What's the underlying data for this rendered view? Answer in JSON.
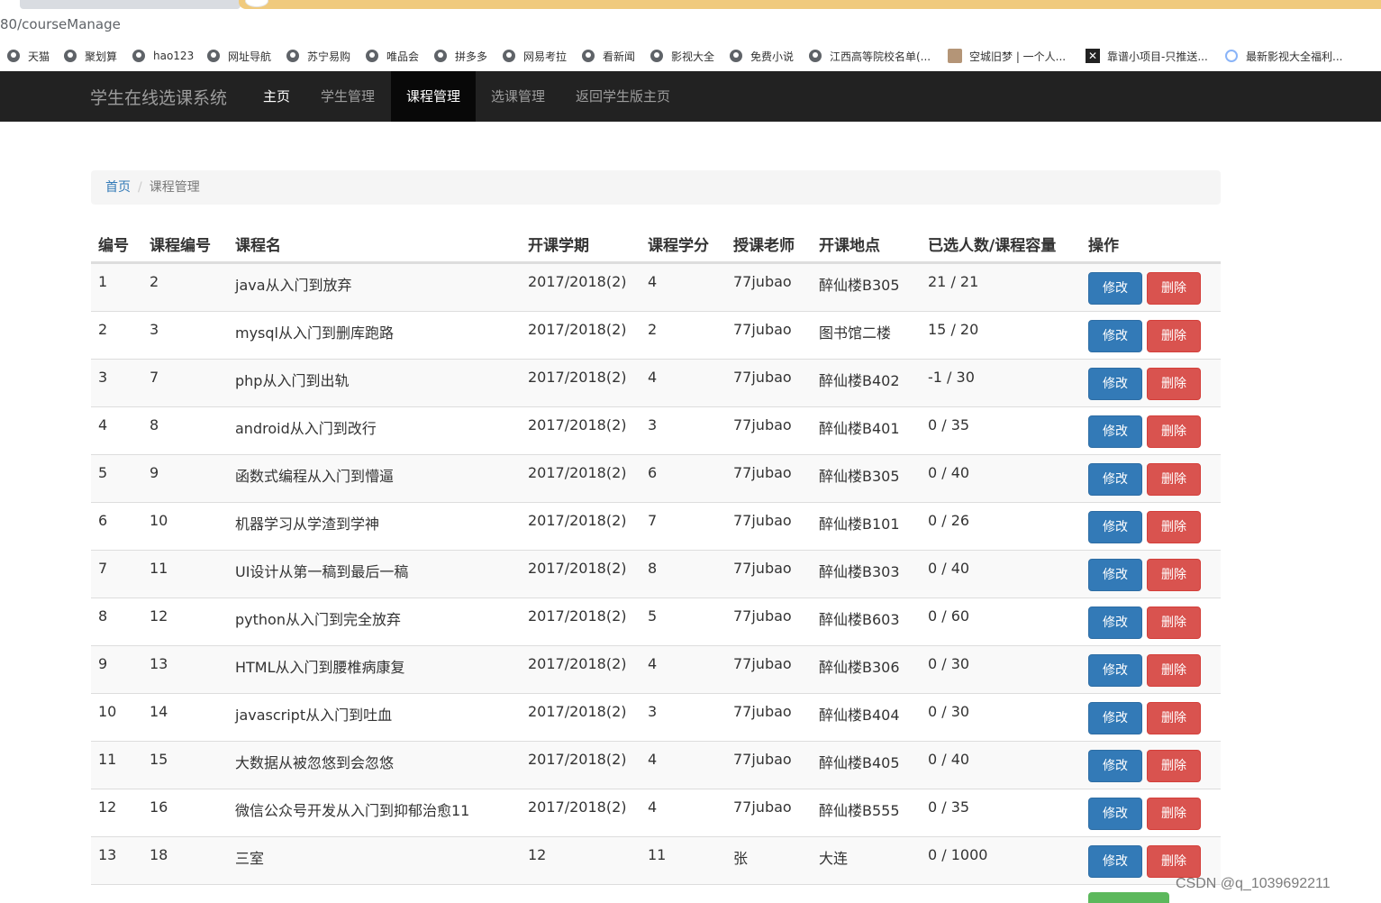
{
  "browser": {
    "url_fragment": "80/courseManage",
    "bookmarks": [
      {
        "label": "天猫",
        "icon": "globe-icon"
      },
      {
        "label": "聚划算",
        "icon": "globe-icon"
      },
      {
        "label": "hao123",
        "icon": "globe-icon"
      },
      {
        "label": "网址导航",
        "icon": "globe-icon"
      },
      {
        "label": "苏宁易购",
        "icon": "globe-icon"
      },
      {
        "label": "唯品会",
        "icon": "globe-icon"
      },
      {
        "label": "拼多多",
        "icon": "globe-icon"
      },
      {
        "label": "网易考拉",
        "icon": "globe-icon"
      },
      {
        "label": "看新闻",
        "icon": "globe-icon"
      },
      {
        "label": "影视大全",
        "icon": "globe-icon"
      },
      {
        "label": "免费小说",
        "icon": "globe-icon"
      },
      {
        "label": "江西高等院校名单(...",
        "icon": "globe-icon"
      },
      {
        "label": "空城旧梦 | 一个人...",
        "icon": "image-icon"
      },
      {
        "label": "靠谱小项目-只推送...",
        "icon": "x-icon"
      },
      {
        "label": "最新影视大全福利...",
        "icon": "circle-icon"
      }
    ]
  },
  "navbar": {
    "brand": "学生在线选课系统",
    "items": [
      "主页",
      "学生管理",
      "课程管理",
      "选课管理",
      "返回学生版主页"
    ],
    "active_index": 2
  },
  "breadcrumb": {
    "home": "首页",
    "separator": "/",
    "current": "课程管理"
  },
  "table": {
    "headers": [
      "编号",
      "课程编号",
      "课程名",
      "开课学期",
      "课程学分",
      "授课老师",
      "开课地点",
      "已选人数/课程容量",
      "操作"
    ],
    "edit_label": "修改",
    "delete_label": "删除",
    "rows": [
      [
        "1",
        "2",
        "java从入门到放弃",
        "2017/2018(2)",
        "4",
        "77jubao",
        "醉仙楼B305",
        "21 / 21"
      ],
      [
        "2",
        "3",
        "mysql从入门到删库跑路",
        "2017/2018(2)",
        "2",
        "77jubao",
        "图书馆二楼",
        "15 / 20"
      ],
      [
        "3",
        "7",
        "php从入门到出轨",
        "2017/2018(2)",
        "4",
        "77jubao",
        "醉仙楼B402",
        "-1 / 30"
      ],
      [
        "4",
        "8",
        "android从入门到改行",
        "2017/2018(2)",
        "3",
        "77jubao",
        "醉仙楼B401",
        "0 / 35"
      ],
      [
        "5",
        "9",
        "函数式编程从入门到懵逼",
        "2017/2018(2)",
        "6",
        "77jubao",
        "醉仙楼B305",
        "0 / 40"
      ],
      [
        "6",
        "10",
        "机器学习从学渣到学神",
        "2017/2018(2)",
        "7",
        "77jubao",
        "醉仙楼B101",
        "0 / 26"
      ],
      [
        "7",
        "11",
        "UI设计从第一稿到最后一稿",
        "2017/2018(2)",
        "8",
        "77jubao",
        "醉仙楼B303",
        "0 / 40"
      ],
      [
        "8",
        "12",
        "python从入门到完全放弃",
        "2017/2018(2)",
        "5",
        "77jubao",
        "醉仙楼B603",
        "0 / 60"
      ],
      [
        "9",
        "13",
        "HTML从入门到腰椎病康复",
        "2017/2018(2)",
        "4",
        "77jubao",
        "醉仙楼B306",
        "0 / 30"
      ],
      [
        "10",
        "14",
        "javascript从入门到吐血",
        "2017/2018(2)",
        "3",
        "77jubao",
        "醉仙楼B404",
        "0 / 30"
      ],
      [
        "11",
        "15",
        "大数据从被忽悠到会忽悠",
        "2017/2018(2)",
        "4",
        "77jubao",
        "醉仙楼B405",
        "0 / 40"
      ],
      [
        "12",
        "16",
        "微信公众号开发从入门到抑郁治愈11",
        "2017/2018(2)",
        "4",
        "77jubao",
        "醉仙楼B555",
        "0 / 35"
      ],
      [
        "13",
        "18",
        "三室",
        "12",
        "11",
        "张",
        "大连",
        "0 / 1000"
      ]
    ]
  },
  "watermark": "CSDN @q_1039692211",
  "colors": {
    "navbar_bg": "#222222",
    "edit_button": "#337ab7",
    "delete_button": "#d9534f",
    "add_button": "#5cb85c",
    "link": "#337ab7"
  }
}
